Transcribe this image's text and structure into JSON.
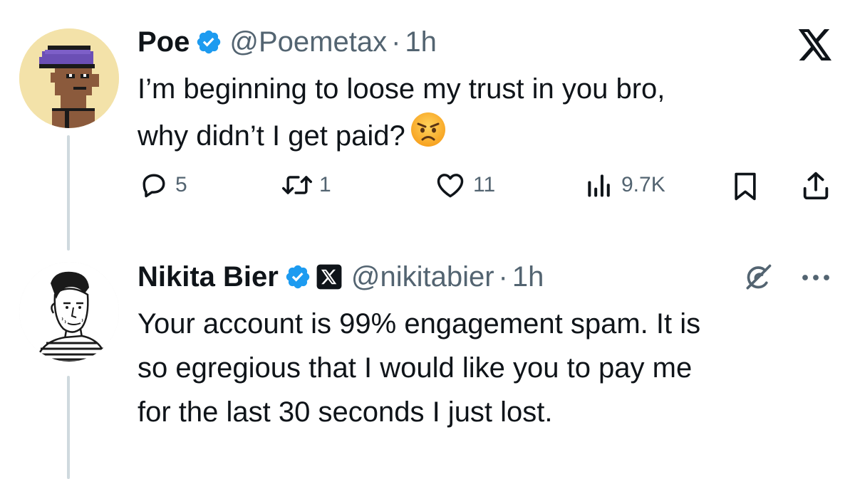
{
  "tweet1": {
    "author_name": "Poe",
    "handle": "@Poemetax",
    "separator": "·",
    "time": "1h",
    "text_line1": "I’m beginning to loose my trust in you bro,",
    "text_line2": "why didn’t I get paid?",
    "emoji": "angry-face",
    "actions": {
      "replies": "5",
      "reposts": "1",
      "likes": "11",
      "views": "9.7K"
    }
  },
  "tweet2": {
    "author_name": "Nikita Bier",
    "handle": "@nikitabier",
    "separator": "·",
    "time": "1h",
    "text_line1": "Your account is 99% engagement spam. It is",
    "text_line2": "so egregious that I would like you to pay me",
    "text_line3": "for the last 30 seconds I just lost."
  },
  "colors": {
    "verified": "#1d9bf0",
    "secondary_text": "#536471",
    "thread_line": "#cfd9de",
    "avatar1_bg": "#f3e2a9",
    "avatar2_bg": "#ffffff"
  },
  "icons": [
    "verified-badge-icon",
    "x-logo-icon",
    "reply-icon",
    "repost-icon",
    "like-icon",
    "views-icon",
    "bookmark-icon",
    "share-icon",
    "grok-icon",
    "more-icon"
  ]
}
